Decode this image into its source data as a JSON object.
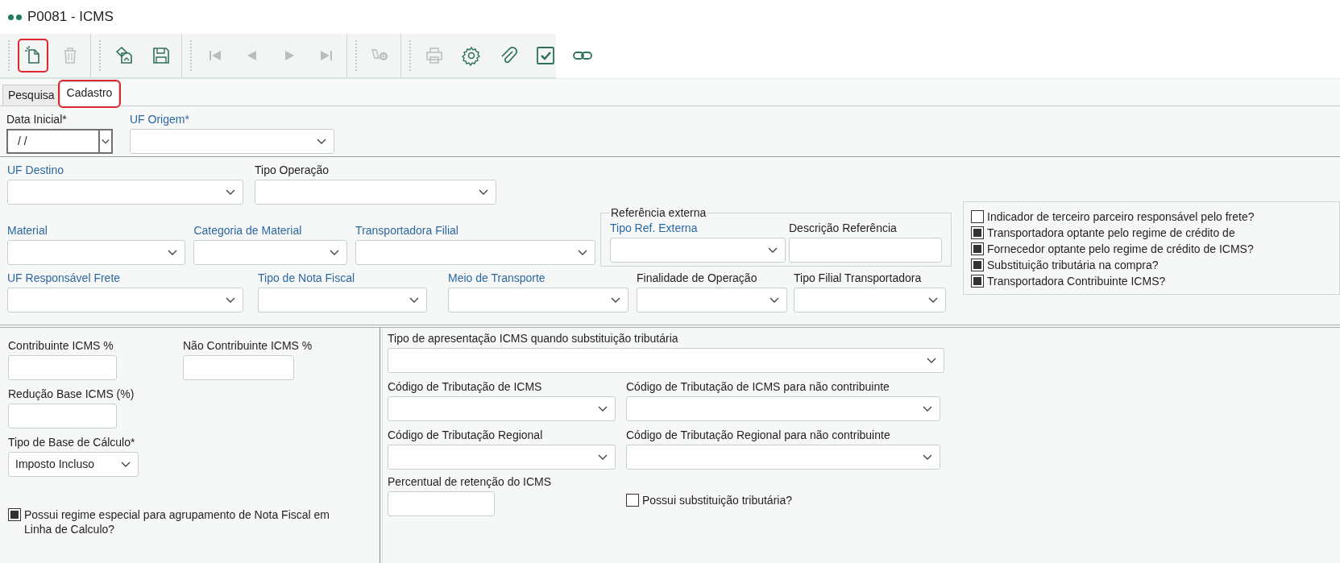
{
  "window": {
    "title": "P0081 - ICMS"
  },
  "toolbar": [
    [
      {
        "kind": "new",
        "disabled": false,
        "highlighted": true
      },
      {
        "kind": "delete",
        "disabled": true,
        "highlighted": false
      }
    ],
    [
      {
        "kind": "copy",
        "disabled": false,
        "highlighted": false
      },
      {
        "kind": "save",
        "disabled": false,
        "highlighted": false
      }
    ],
    [
      {
        "kind": "first",
        "disabled": true,
        "highlighted": false
      },
      {
        "kind": "previous",
        "disabled": true,
        "highlighted": false
      },
      {
        "kind": "next",
        "disabled": true,
        "highlighted": false
      },
      {
        "kind": "last",
        "disabled": true,
        "highlighted": false
      }
    ],
    [
      {
        "kind": "lookup",
        "disabled": true,
        "highlighted": false
      }
    ],
    [
      {
        "kind": "print",
        "disabled": true,
        "highlighted": false
      },
      {
        "kind": "settings",
        "disabled": false,
        "highlighted": false
      },
      {
        "kind": "attach",
        "disabled": false,
        "highlighted": false
      },
      {
        "kind": "confirm",
        "disabled": false,
        "highlighted": false
      },
      {
        "kind": "link",
        "disabled": false,
        "highlighted": false
      }
    ]
  ],
  "tabs": [
    {
      "label": "Pesquisa",
      "selected": false,
      "highlighted": false
    },
    {
      "label": "Cadastro",
      "selected": true,
      "highlighted": true
    }
  ],
  "header": [
    {
      "label": "Data Inicial*",
      "lookup": false,
      "kind": "date",
      "value": "/ /"
    },
    {
      "label": "UF Origem*",
      "lookup": true,
      "kind": "select"
    }
  ],
  "filters": [
    {
      "label": "UF Destino",
      "lookup": true,
      "kind": "select"
    },
    {
      "label": "Tipo Operação",
      "lookup": false,
      "kind": "select"
    },
    {
      "label": "Material",
      "lookup": true,
      "kind": "select"
    },
    {
      "label": "Categoria de Material",
      "lookup": true,
      "kind": "select"
    },
    {
      "label": "Transportadora Filial",
      "lookup": true,
      "kind": "select"
    },
    {
      "label": "UF Responsável Frete",
      "lookup": true,
      "kind": "select"
    },
    {
      "label": "Tipo de Nota Fiscal",
      "lookup": true,
      "kind": "select"
    },
    {
      "label": "Meio de Transporte",
      "lookup": true,
      "kind": "select"
    },
    {
      "label": "Finalidade de Operação",
      "lookup": false,
      "kind": "select"
    },
    {
      "label": "Tipo Filial Transportadora",
      "lookup": false,
      "kind": "select"
    }
  ],
  "external_reference": {
    "title": "Referência externa",
    "fields": [
      {
        "label": "Tipo Ref. Externa",
        "lookup": true,
        "kind": "select"
      },
      {
        "label": "Descrição Referência",
        "lookup": false,
        "kind": "text"
      }
    ]
  },
  "flags": [
    {
      "label": "Indicador de terceiro parceiro responsável pelo frete?",
      "checked": false
    },
    {
      "label": "Transportadora optante pelo regime de crédito de",
      "checked": true
    },
    {
      "label": "Fornecedor optante pelo regime de crédito de ICMS?",
      "checked": true
    },
    {
      "label": "Substituição tributária na compra?",
      "checked": true
    },
    {
      "label": "Transportadora Contribuinte ICMS?",
      "checked": true
    }
  ],
  "rates": [
    {
      "label": "Contribuinte ICMS %",
      "lookup": false,
      "kind": "text"
    },
    {
      "label": "Não Contribuinte ICMS %",
      "lookup": false,
      "kind": "text"
    },
    {
      "label": "Redução Base ICMS (%)",
      "lookup": false,
      "kind": "text"
    },
    {
      "label": "Tipo de Base de Cálculo*",
      "lookup": false,
      "kind": "select",
      "value": "Imposto Incluso"
    }
  ],
  "special_regime": {
    "label": "Possui regime especial para agrupamento de Nota Fiscal em Linha de Calculo?",
    "checked": true
  },
  "substitution": [
    {
      "label": "Tipo de apresentação ICMS quando substituição tributária",
      "lookup": false,
      "kind": "select"
    },
    {
      "label": "Código de Tributação de ICMS",
      "lookup": false,
      "kind": "select"
    },
    {
      "label": "Código de Tributação de ICMS para não contribuinte",
      "lookup": false,
      "kind": "select"
    },
    {
      "label": "Código de Tributação Regional",
      "lookup": false,
      "kind": "select"
    },
    {
      "label": "Código de Tributação Regional para não contribuinte",
      "lookup": false,
      "kind": "select"
    },
    {
      "label": "Percentual de retenção do ICMS",
      "lookup": false,
      "kind": "text"
    }
  ],
  "has_substitution": {
    "label": "Possui substituição tributária?",
    "checked": false
  }
}
